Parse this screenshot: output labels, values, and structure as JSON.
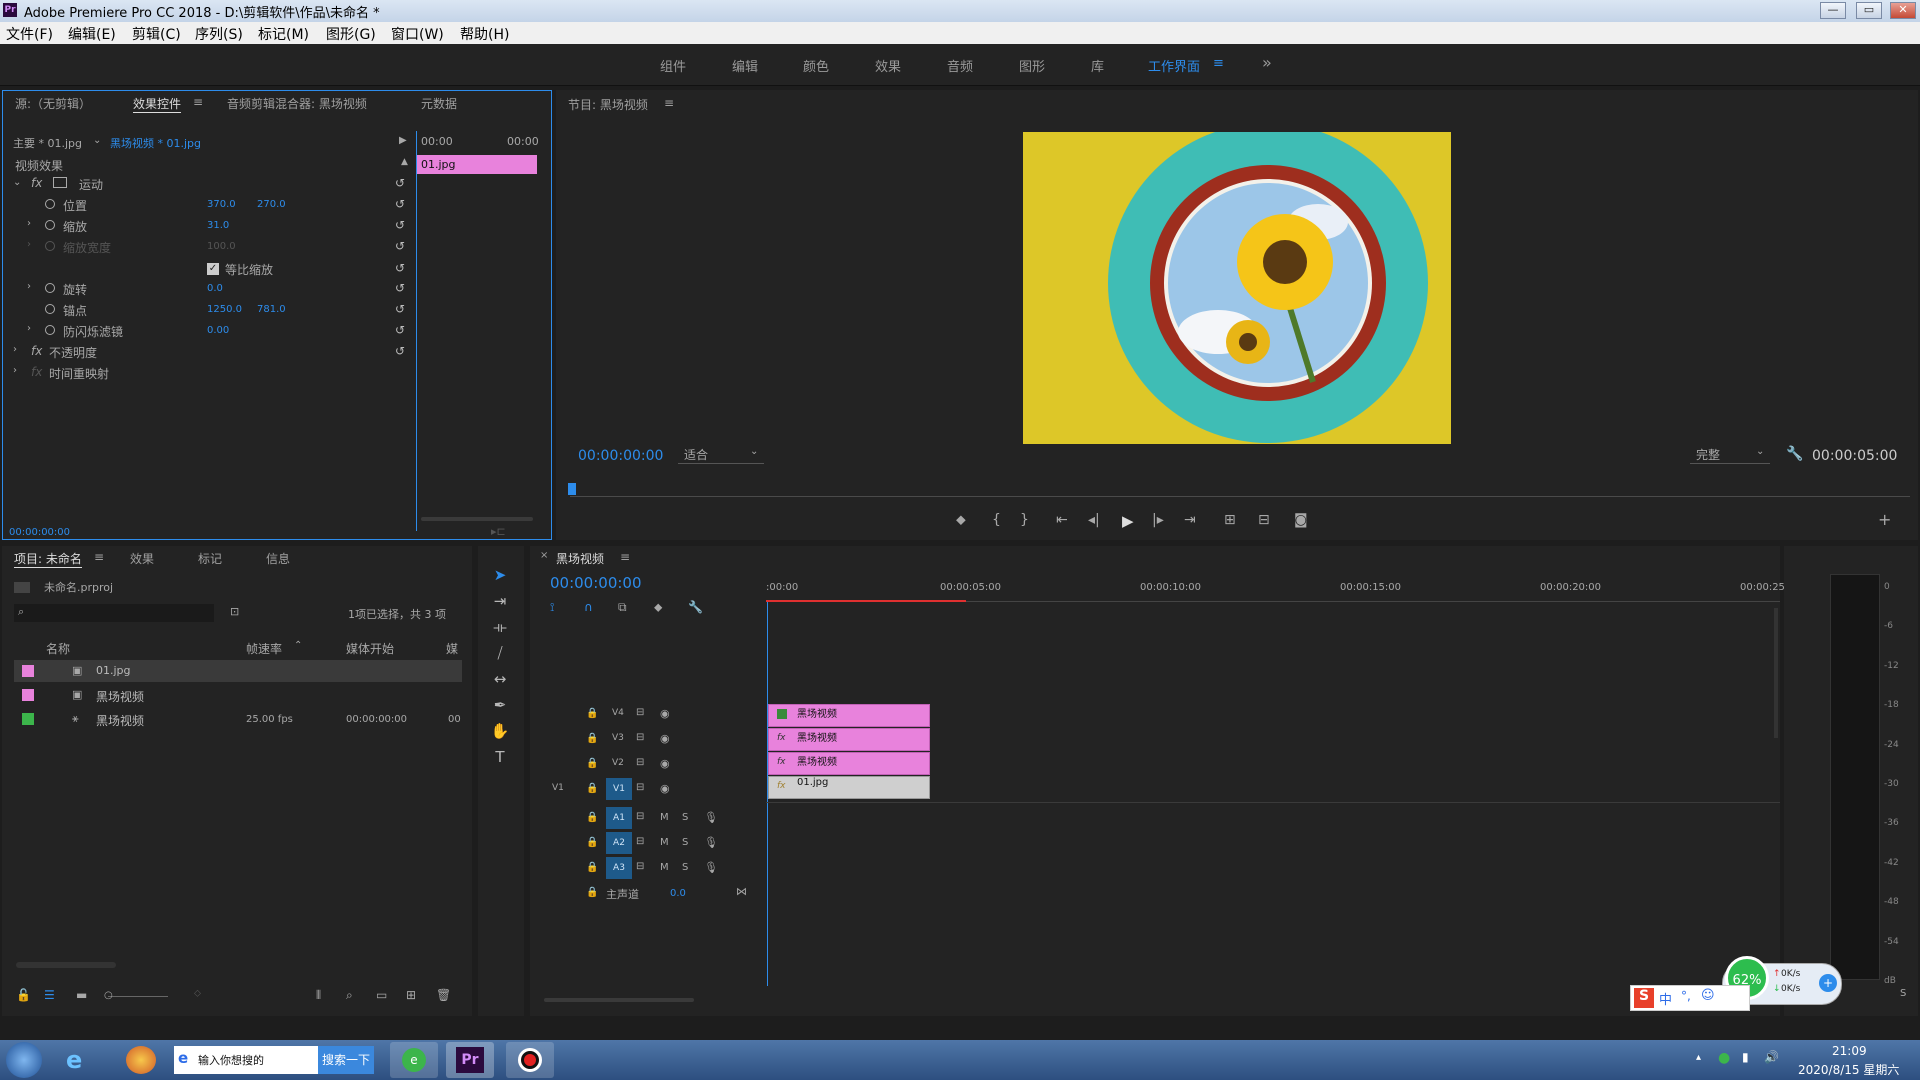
{
  "app": {
    "title": "Adobe Premiere Pro CC 2018 - D:\\剪辑软件\\作品\\未命名 *",
    "window_controls": [
      "—",
      "▭",
      "✕"
    ]
  },
  "menu": [
    "文件(F)",
    "编辑(E)",
    "剪辑(C)",
    "序列(S)",
    "标记(M)",
    "图形(G)",
    "窗口(W)",
    "帮助(H)"
  ],
  "workspaces": [
    "组件",
    "编辑",
    "颜色",
    "效果",
    "音频",
    "图形",
    "库",
    "工作界面",
    "≡",
    "»"
  ],
  "effect_panel": {
    "tabs": [
      "源:（无剪辑）",
      "效果控件",
      "≡",
      "音频剪辑混合器: 黑场视频",
      "元数据"
    ],
    "master": "主要 * 01.jpg",
    "sequence": "黑场视频 * 01.jpg",
    "ruler": [
      "00:00",
      "00:00"
    ],
    "clip_label": "01.jpg",
    "section": "视频效果",
    "motion": "运动",
    "props": [
      {
        "name": "位置",
        "v1": "370.0",
        "v2": "270.0"
      },
      {
        "name": "缩放",
        "v1": "31.0",
        "v2": ""
      },
      {
        "name": "缩放宽度",
        "v1": "100.0",
        "v2": ""
      },
      {
        "name": "等比缩放",
        "v1": "",
        "v2": ""
      },
      {
        "name": "旋转",
        "v1": "0.0",
        "v2": ""
      },
      {
        "name": "锚点",
        "v1": "1250.0",
        "v2": "781.0"
      },
      {
        "name": "防闪烁滤镜",
        "v1": "0.00",
        "v2": ""
      }
    ],
    "opacity": "不透明度",
    "time_remap": "时间重映射",
    "timecode": "00:00:00:00"
  },
  "program": {
    "title": "节目: 黑场视频",
    "menu": "≡",
    "timecode": "00:00:00:00",
    "fit": "适合",
    "quality": "完整",
    "duration": "00:00:05:00",
    "colors": {
      "bg": "#ddc728",
      "ring": "#3fbdb5",
      "inner": "#9e2e1e",
      "sky": "#9cc6e8"
    }
  },
  "project": {
    "tabs": [
      "项目: 未命名",
      "≡",
      "效果",
      "标记",
      "信息"
    ],
    "file": "未命名.prproj",
    "status": "1项已选择，共 3 项",
    "cols": [
      "名称",
      "帧速率",
      "媒体开始",
      "媒"
    ],
    "items": [
      {
        "name": "01.jpg",
        "fps": "",
        "start": "",
        "color": "#e882dc"
      },
      {
        "name": "黑场视频",
        "fps": "",
        "start": "",
        "color": "#e882dc"
      },
      {
        "name": "黑场视频",
        "fps": "25.00 fps",
        "start": "00:00:00:00",
        "color": "#3cb54b",
        "extra": "00"
      }
    ]
  },
  "timeline": {
    "title": "黑场视频",
    "menu": "≡",
    "timecode": "00:00:00:00",
    "ruler": [
      ":00:00",
      "00:00:05:00",
      "00:00:10:00",
      "00:00:15:00",
      "00:00:20:00",
      "00:00:25:"
    ],
    "video_tracks": [
      "V4",
      "V3",
      "V2",
      "V1"
    ],
    "source_patch": "V1",
    "audio_tracks": [
      "A1",
      "A2",
      "A3"
    ],
    "master": "主声道",
    "master_val": "0.0",
    "clips": [
      "黑场视频",
      "黑场视频",
      "黑场视频",
      "01.jpg"
    ],
    "meter": [
      "0",
      "-6",
      "-12",
      "-18",
      "-24",
      "-30",
      "-36",
      "-42",
      "-48",
      "-54",
      "dB"
    ],
    "meter_btn": "S"
  },
  "taskbar": {
    "search_text": "输入你想搜的",
    "search_btn": "搜索一下",
    "clock_time": "21:09",
    "clock_date": "2020/8/15 星期六",
    "ime": "中",
    "net_pct": "62%",
    "up": "0K/s",
    "down": "0K/s"
  }
}
